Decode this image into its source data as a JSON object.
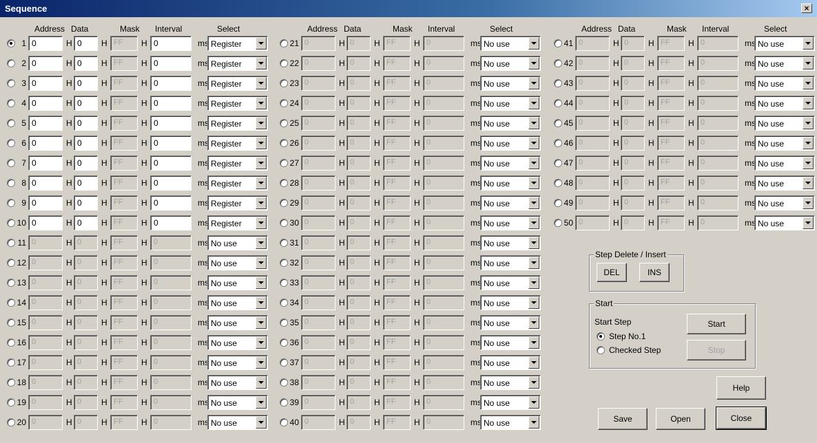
{
  "window": {
    "title": "Sequence",
    "close_glyph": "×"
  },
  "headers": {
    "address": "Address",
    "data": "Data",
    "mask": "Mask",
    "interval": "Interval",
    "select": "Select"
  },
  "units": {
    "h": "H",
    "ms": "ms"
  },
  "selected_step": 1,
  "steps": [
    {
      "num": 1,
      "address": "0",
      "data": "0",
      "mask": "FF",
      "interval": "0",
      "select": "Register",
      "enabled": true
    },
    {
      "num": 2,
      "address": "0",
      "data": "0",
      "mask": "FF",
      "interval": "0",
      "select": "Register",
      "enabled": true
    },
    {
      "num": 3,
      "address": "0",
      "data": "0",
      "mask": "FF",
      "interval": "0",
      "select": "Register",
      "enabled": true
    },
    {
      "num": 4,
      "address": "0",
      "data": "0",
      "mask": "FF",
      "interval": "0",
      "select": "Register",
      "enabled": true
    },
    {
      "num": 5,
      "address": "0",
      "data": "0",
      "mask": "FF",
      "interval": "0",
      "select": "Register",
      "enabled": true
    },
    {
      "num": 6,
      "address": "0",
      "data": "0",
      "mask": "FF",
      "interval": "0",
      "select": "Register",
      "enabled": true
    },
    {
      "num": 7,
      "address": "0",
      "data": "0",
      "mask": "FF",
      "interval": "0",
      "select": "Register",
      "enabled": true
    },
    {
      "num": 8,
      "address": "0",
      "data": "0",
      "mask": "FF",
      "interval": "0",
      "select": "Register",
      "enabled": true
    },
    {
      "num": 9,
      "address": "0",
      "data": "0",
      "mask": "FF",
      "interval": "0",
      "select": "Register",
      "enabled": true
    },
    {
      "num": 10,
      "address": "0",
      "data": "0",
      "mask": "FF",
      "interval": "0",
      "select": "Register",
      "enabled": true
    },
    {
      "num": 11,
      "address": "0",
      "data": "0",
      "mask": "FF",
      "interval": "0",
      "select": "No use",
      "enabled": false
    },
    {
      "num": 12,
      "address": "0",
      "data": "0",
      "mask": "FF",
      "interval": "0",
      "select": "No use",
      "enabled": false
    },
    {
      "num": 13,
      "address": "0",
      "data": "0",
      "mask": "FF",
      "interval": "0",
      "select": "No use",
      "enabled": false
    },
    {
      "num": 14,
      "address": "0",
      "data": "0",
      "mask": "FF",
      "interval": "0",
      "select": "No use",
      "enabled": false
    },
    {
      "num": 15,
      "address": "0",
      "data": "0",
      "mask": "FF",
      "interval": "0",
      "select": "No use",
      "enabled": false
    },
    {
      "num": 16,
      "address": "0",
      "data": "0",
      "mask": "FF",
      "interval": "0",
      "select": "No use",
      "enabled": false
    },
    {
      "num": 17,
      "address": "0",
      "data": "0",
      "mask": "FF",
      "interval": "0",
      "select": "No use",
      "enabled": false
    },
    {
      "num": 18,
      "address": "0",
      "data": "0",
      "mask": "FF",
      "interval": "0",
      "select": "No use",
      "enabled": false
    },
    {
      "num": 19,
      "address": "0",
      "data": "0",
      "mask": "FF",
      "interval": "0",
      "select": "No use",
      "enabled": false
    },
    {
      "num": 20,
      "address": "0",
      "data": "0",
      "mask": "FF",
      "interval": "0",
      "select": "No use",
      "enabled": false
    },
    {
      "num": 21,
      "address": "0",
      "data": "0",
      "mask": "FF",
      "interval": "0",
      "select": "No use",
      "enabled": false
    },
    {
      "num": 22,
      "address": "0",
      "data": "0",
      "mask": "FF",
      "interval": "0",
      "select": "No use",
      "enabled": false
    },
    {
      "num": 23,
      "address": "0",
      "data": "0",
      "mask": "FF",
      "interval": "0",
      "select": "No use",
      "enabled": false
    },
    {
      "num": 24,
      "address": "0",
      "data": "0",
      "mask": "FF",
      "interval": "0",
      "select": "No use",
      "enabled": false
    },
    {
      "num": 25,
      "address": "0",
      "data": "0",
      "mask": "FF",
      "interval": "0",
      "select": "No use",
      "enabled": false
    },
    {
      "num": 26,
      "address": "0",
      "data": "0",
      "mask": "FF",
      "interval": "0",
      "select": "No use",
      "enabled": false
    },
    {
      "num": 27,
      "address": "0",
      "data": "0",
      "mask": "FF",
      "interval": "0",
      "select": "No use",
      "enabled": false
    },
    {
      "num": 28,
      "address": "0",
      "data": "0",
      "mask": "FF",
      "interval": "0",
      "select": "No use",
      "enabled": false
    },
    {
      "num": 29,
      "address": "0",
      "data": "0",
      "mask": "FF",
      "interval": "0",
      "select": "No use",
      "enabled": false
    },
    {
      "num": 30,
      "address": "0",
      "data": "0",
      "mask": "FF",
      "interval": "0",
      "select": "No use",
      "enabled": false
    },
    {
      "num": 31,
      "address": "0",
      "data": "0",
      "mask": "FF",
      "interval": "0",
      "select": "No use",
      "enabled": false
    },
    {
      "num": 32,
      "address": "0",
      "data": "0",
      "mask": "FF",
      "interval": "0",
      "select": "No use",
      "enabled": false
    },
    {
      "num": 33,
      "address": "0",
      "data": "0",
      "mask": "FF",
      "interval": "0",
      "select": "No use",
      "enabled": false
    },
    {
      "num": 34,
      "address": "0",
      "data": "0",
      "mask": "FF",
      "interval": "0",
      "select": "No use",
      "enabled": false
    },
    {
      "num": 35,
      "address": "0",
      "data": "0",
      "mask": "FF",
      "interval": "0",
      "select": "No use",
      "enabled": false
    },
    {
      "num": 36,
      "address": "0",
      "data": "0",
      "mask": "FF",
      "interval": "0",
      "select": "No use",
      "enabled": false
    },
    {
      "num": 37,
      "address": "0",
      "data": "0",
      "mask": "FF",
      "interval": "0",
      "select": "No use",
      "enabled": false
    },
    {
      "num": 38,
      "address": "0",
      "data": "0",
      "mask": "FF",
      "interval": "0",
      "select": "No use",
      "enabled": false
    },
    {
      "num": 39,
      "address": "0",
      "data": "0",
      "mask": "FF",
      "interval": "0",
      "select": "No use",
      "enabled": false
    },
    {
      "num": 40,
      "address": "0",
      "data": "0",
      "mask": "FF",
      "interval": "0",
      "select": "No use",
      "enabled": false
    },
    {
      "num": 41,
      "address": "0",
      "data": "0",
      "mask": "FF",
      "interval": "0",
      "select": "No use",
      "enabled": false
    },
    {
      "num": 42,
      "address": "0",
      "data": "0",
      "mask": "FF",
      "interval": "0",
      "select": "No use",
      "enabled": false
    },
    {
      "num": 43,
      "address": "0",
      "data": "0",
      "mask": "FF",
      "interval": "0",
      "select": "No use",
      "enabled": false
    },
    {
      "num": 44,
      "address": "0",
      "data": "0",
      "mask": "FF",
      "interval": "0",
      "select": "No use",
      "enabled": false
    },
    {
      "num": 45,
      "address": "0",
      "data": "0",
      "mask": "FF",
      "interval": "0",
      "select": "No use",
      "enabled": false
    },
    {
      "num": 46,
      "address": "0",
      "data": "0",
      "mask": "FF",
      "interval": "0",
      "select": "No use",
      "enabled": false
    },
    {
      "num": 47,
      "address": "0",
      "data": "0",
      "mask": "FF",
      "interval": "0",
      "select": "No use",
      "enabled": false
    },
    {
      "num": 48,
      "address": "0",
      "data": "0",
      "mask": "FF",
      "interval": "0",
      "select": "No use",
      "enabled": false
    },
    {
      "num": 49,
      "address": "0",
      "data": "0",
      "mask": "FF",
      "interval": "0",
      "select": "No use",
      "enabled": false
    },
    {
      "num": 50,
      "address": "0",
      "data": "0",
      "mask": "FF",
      "interval": "0",
      "select": "No use",
      "enabled": false
    }
  ],
  "step_edit": {
    "group_label": "Step Delete / Insert",
    "del_label": "DEL",
    "ins_label": "INS"
  },
  "start_group": {
    "group_label": "Start",
    "start_step_label": "Start Step",
    "option1_label": "Step No.1",
    "option2_label": "Checked Step",
    "selected_option": 1,
    "start_label": "Start",
    "stop_label": "Stop"
  },
  "buttons": {
    "help_label": "Help",
    "save_label": "Save",
    "open_label": "Open",
    "close_label": "Close"
  },
  "colors": {
    "face": "#d4d0c8",
    "title_start": "#0a246a",
    "title_end": "#a6caf0",
    "disabled_text": "#a0a0a0"
  }
}
